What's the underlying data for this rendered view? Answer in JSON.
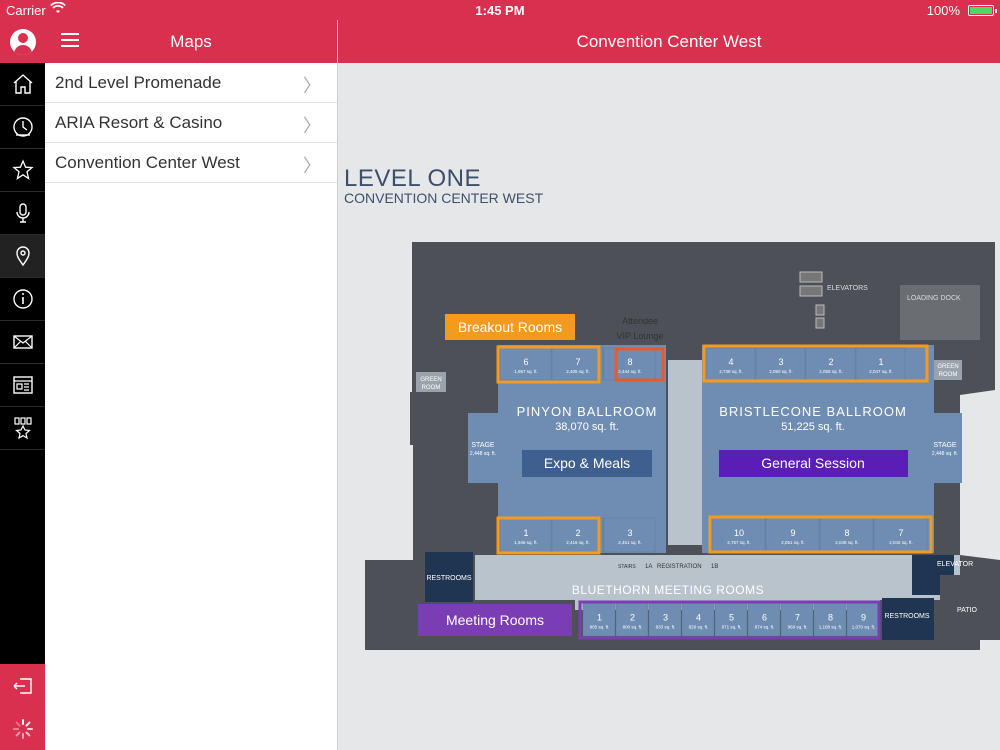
{
  "status_bar": {
    "carrier": "Carrier",
    "time": "1:45 PM",
    "battery_percent": "100%",
    "battery_level": 1.0
  },
  "sidebar": {
    "icons": [
      "user-avatar-icon",
      "home-icon",
      "clock-icon",
      "star-icon",
      "microphone-icon",
      "map-pin-icon",
      "info-icon",
      "mail-icon",
      "news-icon",
      "badge-icon"
    ],
    "active": "map-pin-icon",
    "bottom_icons": [
      "logout-icon",
      "spinner-icon"
    ]
  },
  "maps_panel": {
    "title": "Maps",
    "items": [
      {
        "label": "2nd Level Promenade"
      },
      {
        "label": "ARIA Resort & Casino"
      },
      {
        "label": "Convention Center West"
      }
    ]
  },
  "main": {
    "title": "Convention Center West",
    "map": {
      "level_title": "LEVEL ONE",
      "level_subtitle": "CONVENTION CENTER WEST",
      "callouts": {
        "breakout": "Breakout Rooms",
        "expo": "Expo & Meals",
        "general": "General Session",
        "meeting": "Meeting Rooms"
      },
      "ballrooms": {
        "pinyon_name": "PINYON BALLROOM",
        "pinyon_size": "38,070 sq. ft.",
        "bristlecone_name": "BRISTLECONE BALLROOM",
        "bristlecone_size": "51,225 sq. ft."
      },
      "labels": {
        "attendee": "Attendee",
        "vip_lounge": "VIP Lounge",
        "elevators": "ELEVATORS",
        "loading_dock": "LOADING DOCK",
        "green_room": "GREEN",
        "green_room_2": "ROOM",
        "stage": "STAGE",
        "stage_size": "2,448 sq. ft.",
        "restrooms": "RESTROOMS",
        "elevator": "ELEVATOR",
        "patio": "PATIO",
        "stairs": "STAIRS",
        "registration": "REGISTRATION",
        "reg_1a": "1A",
        "reg_1b": "1B",
        "bluethorn": "BLUETHORN MEETING ROOMS"
      },
      "pinyon_top_rooms": [
        {
          "num": "6",
          "size": "1,967 sq. ft."
        },
        {
          "num": "7",
          "size": "2,405 sq. ft."
        },
        {
          "num": "8",
          "size": "2,444 sq. ft."
        }
      ],
      "pinyon_bottom_rooms": [
        {
          "num": "1",
          "size": "1,946 sq. ft."
        },
        {
          "num": "2",
          "size": "2,416 sq. ft."
        },
        {
          "num": "3",
          "size": "2,451 sq. ft."
        }
      ],
      "bristlecone_top_rooms": [
        {
          "num": "4",
          "size": "2,738 sq. ft."
        },
        {
          "num": "3",
          "size": "2,050 sq. ft."
        },
        {
          "num": "2",
          "size": "2,058 sq. ft."
        },
        {
          "num": "1",
          "size": "2,047 sq. ft."
        }
      ],
      "bristlecone_bottom_rooms": [
        {
          "num": "10",
          "size": "2,757 sq. ft."
        },
        {
          "num": "9",
          "size": "2,051 sq. ft."
        },
        {
          "num": "8",
          "size": "2,048 sq. ft."
        },
        {
          "num": "7",
          "size": "2,042 sq. ft."
        }
      ],
      "bluethorn_rooms": [
        {
          "num": "1",
          "size": "905 sq. ft."
        },
        {
          "num": "2",
          "size": "800 sq. ft."
        },
        {
          "num": "3",
          "size": "833 sq. ft."
        },
        {
          "num": "4",
          "size": "829 sq. ft."
        },
        {
          "num": "5",
          "size": "871 sq. ft."
        },
        {
          "num": "6",
          "size": "874 sq. ft."
        },
        {
          "num": "7",
          "size": "969 sq. ft."
        },
        {
          "num": "8",
          "size": "1,108 sq. ft."
        },
        {
          "num": "9",
          "size": "1,070 sq. ft."
        }
      ],
      "colors": {
        "building": "#4d5056",
        "room": "#6f8db3",
        "corridor": "#b9c3cc",
        "orange_outline": "#f39a1f",
        "red_outline": "#e85a2a",
        "purple_outline": "#7b3db3",
        "expo_fill": "#3f5f8f",
        "general_fill": "#5a1db5",
        "meeting_fill": "#7b3db3",
        "breakout_fill": "#f39a1f",
        "brand": "#d9304f"
      }
    }
  }
}
